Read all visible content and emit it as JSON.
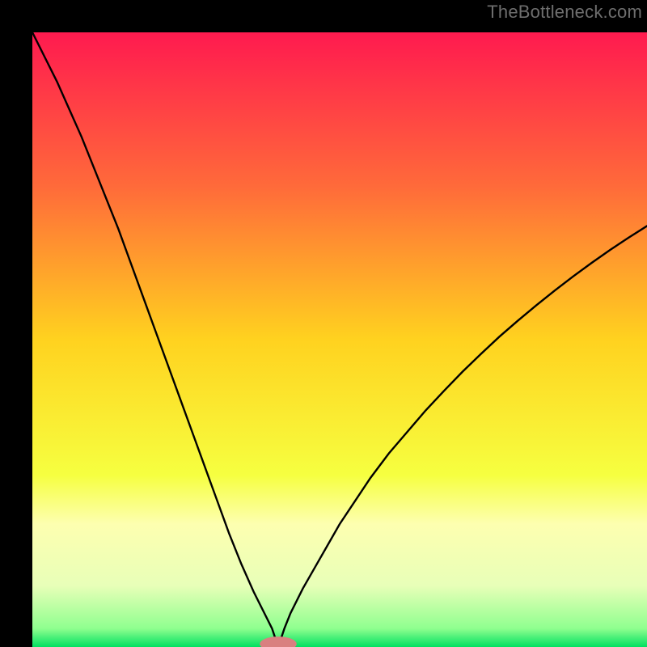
{
  "watermark": "TheBottleneck.com",
  "chart_data": {
    "type": "line",
    "title": "",
    "xlabel": "",
    "ylabel": "",
    "xlim": [
      0,
      100
    ],
    "ylim": [
      0,
      100
    ],
    "notch_x": 40,
    "marker": {
      "x": 40,
      "y": 0.5,
      "color": "#d98080",
      "rx": 3,
      "ry": 1.2
    },
    "gradient_stops": [
      {
        "offset": 0,
        "color": "#ff1a4f"
      },
      {
        "offset": 25,
        "color": "#ff6a3a"
      },
      {
        "offset": 50,
        "color": "#ffd21f"
      },
      {
        "offset": 72,
        "color": "#f6ff40"
      },
      {
        "offset": 80,
        "color": "#fdffb0"
      },
      {
        "offset": 90,
        "color": "#e8ffb8"
      },
      {
        "offset": 97,
        "color": "#8fff8f"
      },
      {
        "offset": 100,
        "color": "#00e060"
      }
    ],
    "series": [
      {
        "name": "left-branch",
        "x": [
          0,
          2,
          4,
          6,
          8,
          10,
          12,
          14,
          16,
          18,
          20,
          22,
          24,
          26,
          28,
          30,
          32,
          34,
          36,
          38,
          39,
          39.6,
          40
        ],
        "y": [
          100,
          96,
          92,
          87.5,
          83,
          78,
          73,
          68,
          62.5,
          57,
          51.5,
          46,
          40.5,
          35,
          29.5,
          24,
          18.5,
          13.5,
          9,
          5,
          3,
          1.2,
          0.5
        ]
      },
      {
        "name": "right-branch",
        "x": [
          40,
          40.4,
          41,
          42,
          44,
          46,
          48,
          50,
          52,
          55,
          58,
          61,
          64,
          67,
          70,
          73,
          76,
          79,
          82,
          85,
          88,
          91,
          94,
          97,
          100
        ],
        "y": [
          0.5,
          1.2,
          3,
          5.5,
          9.5,
          13,
          16.5,
          20,
          23,
          27.5,
          31.5,
          35,
          38.5,
          41.7,
          44.8,
          47.7,
          50.5,
          53.1,
          55.6,
          58,
          60.3,
          62.5,
          64.6,
          66.6,
          68.5
        ]
      }
    ]
  }
}
